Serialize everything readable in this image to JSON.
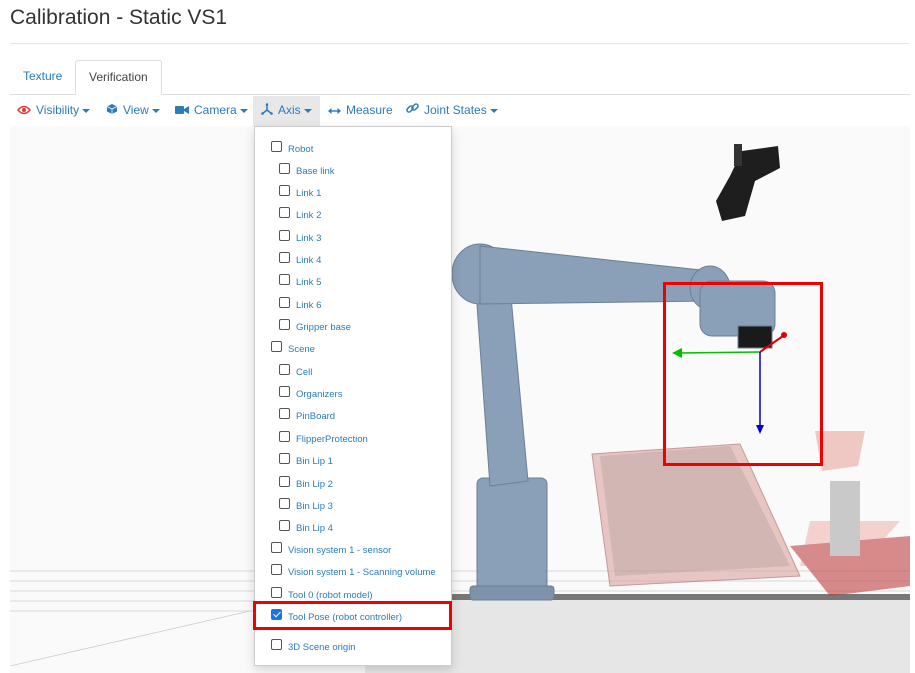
{
  "title": "Calibration - Static VS1",
  "tabs": [
    {
      "label": "Texture",
      "active": false
    },
    {
      "label": "Verification",
      "active": true
    }
  ],
  "toolbar": {
    "visibility": "Visibility",
    "view": "View",
    "camera": "Camera",
    "axis": "Axis",
    "measure": "Measure",
    "joint_states": "Joint States"
  },
  "axis_menu": {
    "items": [
      {
        "label": "Robot",
        "checked": false,
        "level": 0
      },
      {
        "label": "Base link",
        "checked": false,
        "level": 1
      },
      {
        "label": "Link 1",
        "checked": false,
        "level": 1
      },
      {
        "label": "Link 2",
        "checked": false,
        "level": 1
      },
      {
        "label": "Link 3",
        "checked": false,
        "level": 1
      },
      {
        "label": "Link 4",
        "checked": false,
        "level": 1
      },
      {
        "label": "Link 5",
        "checked": false,
        "level": 1
      },
      {
        "label": "Link 6",
        "checked": false,
        "level": 1
      },
      {
        "label": "Gripper base",
        "checked": false,
        "level": 1
      },
      {
        "label": "Scene",
        "checked": false,
        "level": 0
      },
      {
        "label": "Cell",
        "checked": false,
        "level": 1
      },
      {
        "label": "Organizers",
        "checked": false,
        "level": 1
      },
      {
        "label": "PinBoard",
        "checked": false,
        "level": 1
      },
      {
        "label": "FlipperProtection",
        "checked": false,
        "level": 1
      },
      {
        "label": "Bin Lip 1",
        "checked": false,
        "level": 1
      },
      {
        "label": "Bin Lip 2",
        "checked": false,
        "level": 1
      },
      {
        "label": "Bin Lip 3",
        "checked": false,
        "level": 1
      },
      {
        "label": "Bin Lip 4",
        "checked": false,
        "level": 1
      },
      {
        "label": "Vision system 1 - sensor",
        "checked": false,
        "level": 0
      },
      {
        "label": "Vision system 1 - Scanning volume",
        "checked": false,
        "level": 0
      },
      {
        "label": "Tool 0 (robot model)",
        "checked": false,
        "level": 0
      },
      {
        "label": "Tool Pose (robot controller)",
        "checked": true,
        "level": 0
      },
      {
        "label": "3D Scene origin",
        "checked": false,
        "level": 0
      }
    ]
  },
  "colors": {
    "link": "#2b7bbd",
    "highlight": "#e00000",
    "axis_x": "#00c000",
    "axis_y": "#e00000",
    "axis_z": "#0000d0",
    "robot": "#8a9fb8",
    "checkbox_checked": "#1a73e8"
  },
  "icons": [
    "eye-icon",
    "cube-icon",
    "video-camera-icon",
    "axis-icon",
    "measure-arrows-icon",
    "link-icon"
  ]
}
